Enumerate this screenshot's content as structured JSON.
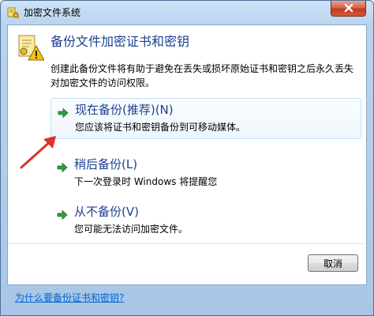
{
  "window": {
    "title": "加密文件系统"
  },
  "header": {
    "heading": "备份文件加密证书和密钥",
    "description": "创建此备份文件将有助于避免在丢失或损坏原始证书和密钥之后永久丢失对加密文件的访问权限。"
  },
  "options": [
    {
      "title": "现在备份(推荐)(N)",
      "subtitle": "您应该将证书和密钥备份到可移动媒体。",
      "state": "hover"
    },
    {
      "title": "稍后备份(L)",
      "subtitle": "下一次登录时 Windows 将提醒您",
      "state": "normal"
    },
    {
      "title": "从不备份(V)",
      "subtitle": "您可能无法访问加密文件。",
      "state": "normal"
    }
  ],
  "buttons": {
    "cancel": "取消"
  },
  "footer": {
    "help_link": "为什么要备份证书和密钥?"
  },
  "colors": {
    "heading_blue": "#1e3f8f",
    "link_blue": "#0066cc",
    "arrow_green": "#2e9e3a",
    "annotation_red": "#e0302b"
  },
  "icons": {
    "title": "certificate-key-icon",
    "header": "certificate-warning-icon",
    "option_arrow": "green-arrow-icon",
    "close": "close-icon"
  }
}
